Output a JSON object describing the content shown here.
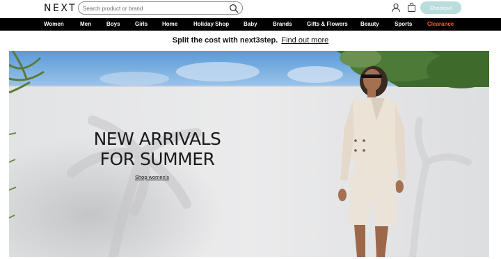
{
  "header": {
    "logo": "NEXT",
    "search_placeholder": "Search product or brand",
    "checkout_label": "Checkout"
  },
  "nav": {
    "items": [
      {
        "label": "Women"
      },
      {
        "label": "Men"
      },
      {
        "label": "Boys"
      },
      {
        "label": "Girls"
      },
      {
        "label": "Home"
      },
      {
        "label": "Holiday Shop"
      },
      {
        "label": "Baby"
      },
      {
        "label": "Brands"
      },
      {
        "label": "Gifts & Flowers"
      },
      {
        "label": "Beauty"
      },
      {
        "label": "Sports"
      },
      {
        "label": "Clearance"
      }
    ]
  },
  "promo": {
    "text": "Split the cost with next3step.",
    "link": "Find out more"
  },
  "hero": {
    "headline_line1": "NEW ARRIVALS",
    "headline_line2": "FOR SUMMER",
    "cta": "Shop women's"
  },
  "colors": {
    "nav_bg": "#000000",
    "clearance": "#ff5a36",
    "checkout_bg": "#b9dcdc"
  }
}
